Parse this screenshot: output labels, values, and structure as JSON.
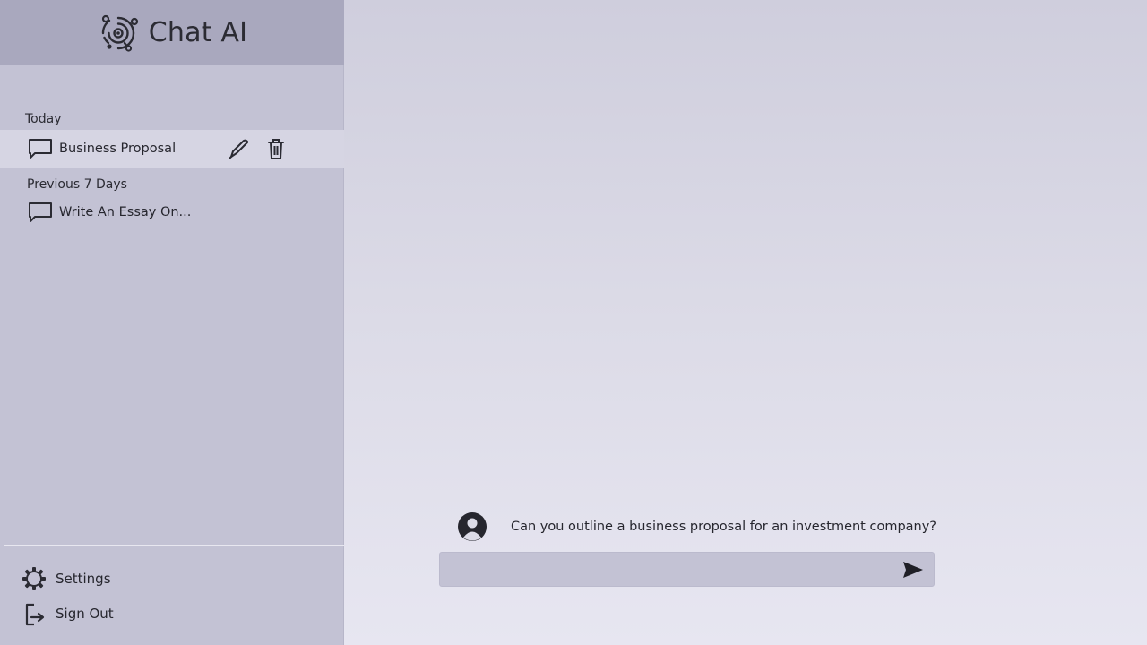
{
  "app": {
    "title": "Chat AI"
  },
  "sidebar": {
    "sections": [
      {
        "label": "Today",
        "items": [
          {
            "label": "Business Proposal",
            "active": true,
            "icon": "chat-bubble-icon"
          }
        ]
      },
      {
        "label": "Previous 7 Days",
        "items": [
          {
            "label": "Write An Essay On...",
            "active": false,
            "icon": "chat-bubble-icon"
          }
        ]
      }
    ],
    "item_actions": [
      "pencil-icon",
      "trash-icon"
    ],
    "footer": {
      "settings_label": "Settings",
      "signout_label": "Sign Out"
    }
  },
  "conversation": {
    "messages": [
      {
        "role": "user",
        "icon": "user-avatar-icon",
        "text": "Can you outline a business proposal for an investment company?"
      }
    ]
  },
  "composer": {
    "value": "",
    "placeholder": "",
    "send_icon": "send-icon"
  },
  "colors": {
    "sidebar": "#c3c2d4",
    "brand_bar": "#a9a8be",
    "active_item": "#d6d5e3",
    "main_top": "#cfcedd",
    "main_bottom": "#e7e6f1",
    "text": "#26262e"
  }
}
